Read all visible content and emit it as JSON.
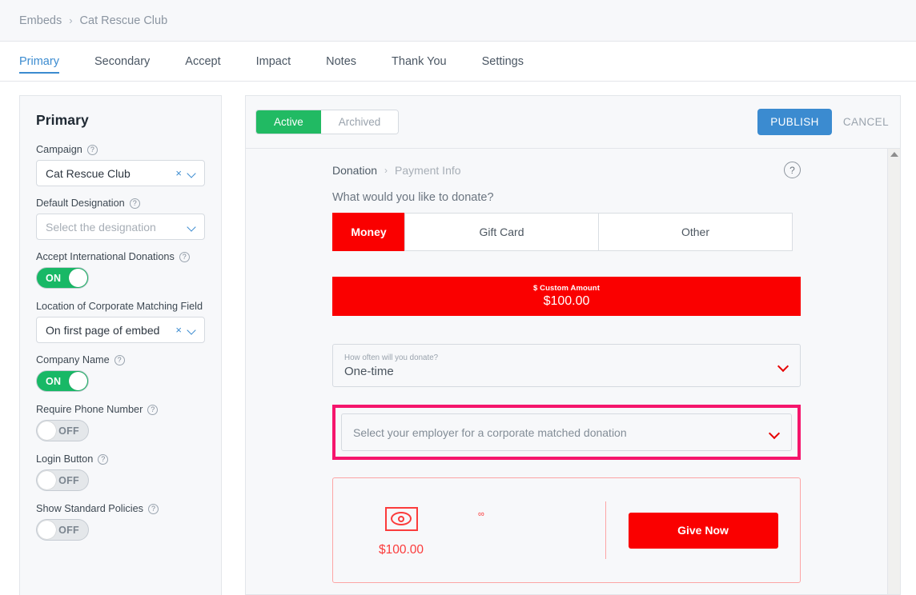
{
  "breadcrumb": {
    "root": "Embeds",
    "separator": "›",
    "current": "Cat Rescue Club"
  },
  "tabs": [
    {
      "label": "Primary",
      "active": true
    },
    {
      "label": "Secondary",
      "active": false
    },
    {
      "label": "Accept",
      "active": false
    },
    {
      "label": "Impact",
      "active": false
    },
    {
      "label": "Notes",
      "active": false
    },
    {
      "label": "Thank You",
      "active": false
    },
    {
      "label": "Settings",
      "active": false
    }
  ],
  "sidebar": {
    "title": "Primary",
    "help_glyph": "?",
    "clear_glyph": "×",
    "fields": [
      {
        "label": "Campaign",
        "has_help": true,
        "value": "Cat Rescue Club",
        "is_placeholder": false,
        "clearable": true
      },
      {
        "label": "Default Designation",
        "has_help": true,
        "value": "Select the designation",
        "is_placeholder": true,
        "clearable": false
      }
    ],
    "toggle_international": {
      "label": "Accept International Donations",
      "has_help": true,
      "state": "ON"
    },
    "field_location": {
      "label": "Location of Corporate Matching Field",
      "has_help": false,
      "value": "On first page of embed",
      "is_placeholder": false,
      "clearable": true
    },
    "toggles": [
      {
        "label": "Company Name",
        "has_help": true,
        "state": "ON"
      },
      {
        "label": "Require Phone Number",
        "has_help": true,
        "state": "OFF"
      },
      {
        "label": "Login Button",
        "has_help": true,
        "state": "OFF"
      },
      {
        "label": "Show Standard Policies",
        "has_help": true,
        "state": "OFF"
      }
    ]
  },
  "toolbar": {
    "segment_active": "Active",
    "segment_archived": "Archived",
    "publish_label": "PUBLISH",
    "cancel_label": "CANCEL"
  },
  "preview": {
    "crumb_current": "Donation",
    "crumb_separator": "›",
    "crumb_next": "Payment Info",
    "help_glyph": "?",
    "question": "What would you like to donate?",
    "donation_types": [
      {
        "label": "Money",
        "selected": true
      },
      {
        "label": "Gift Card",
        "selected": false
      },
      {
        "label": "Other",
        "selected": false
      }
    ],
    "amount_banner": {
      "caption": "$ Custom Amount",
      "amount": "$100.00"
    },
    "frequency": {
      "label": "How often will you donate?",
      "value": "One-time"
    },
    "employer": {
      "placeholder": "Select your employer for a corporate matched donation"
    },
    "summary": {
      "amount": "$100.00",
      "recurrence_glyph": "∞",
      "give_label": "Give Now"
    }
  },
  "colors": {
    "accent_red": "#fa0000",
    "accent_green": "#21ba63",
    "accent_blue": "#3b8bd0",
    "highlight_pink": "#f5156c",
    "toggle_on_green": "#18b866"
  }
}
